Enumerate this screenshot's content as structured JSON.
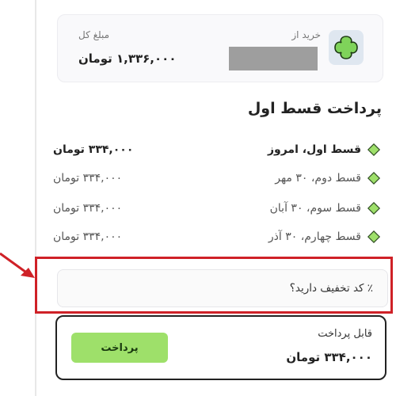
{
  "summary": {
    "from_label": "خرید از",
    "total_label": "مبلغ کل",
    "total_value": "۱,۳۳۶,۰۰۰ تومان"
  },
  "section_title": "پرداخت قسط اول",
  "installments": [
    {
      "label": "قسط اول، امروز",
      "amount": "۳۳۴,۰۰۰ تومان",
      "current": true
    },
    {
      "label": "قسط دوم، ۳۰ مهر",
      "amount": "۳۳۴,۰۰۰ تومان",
      "current": false
    },
    {
      "label": "قسط سوم، ۳۰ آبان",
      "amount": "۳۳۴,۰۰۰ تومان",
      "current": false
    },
    {
      "label": "قسط چهارم، ۳۰ آذر",
      "amount": "۳۳۴,۰۰۰ تومان",
      "current": false
    }
  ],
  "coupon": {
    "label": "٪ کد تخفیف دارید؟"
  },
  "payment": {
    "label": "قابل پرداخت",
    "value": "۳۳۴,۰۰۰ تومان",
    "button": "پرداخت"
  },
  "colors": {
    "accent_green": "#9ee06a",
    "highlight_red": "#cf2127",
    "logo_green": "#7fd35a"
  }
}
